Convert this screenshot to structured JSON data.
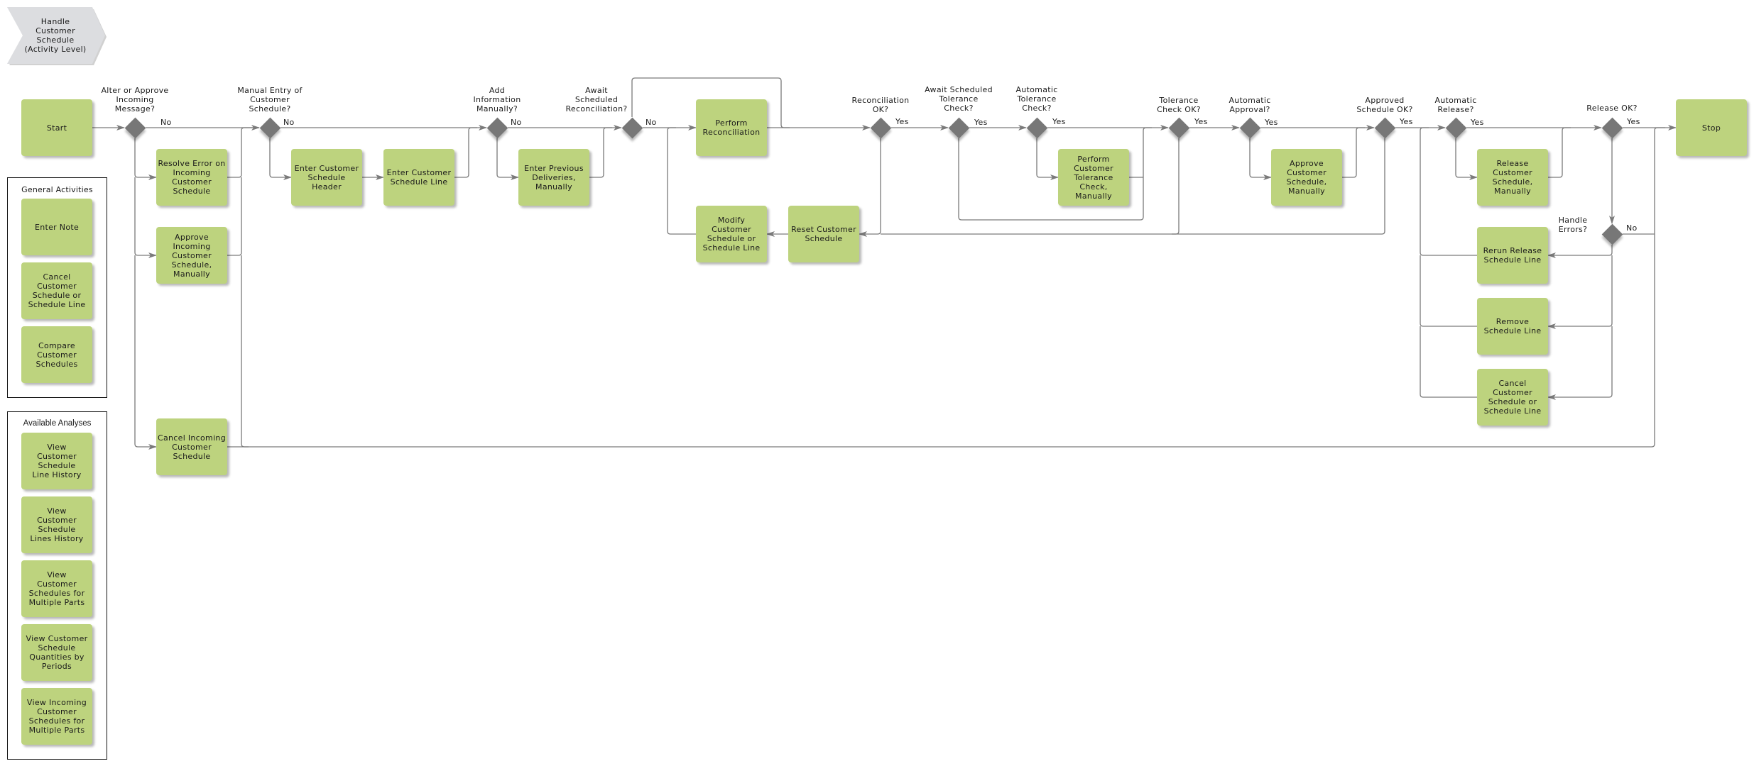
{
  "header": {
    "title": "Handle\nCustomer\nSchedule\n(Activity Level)"
  },
  "colors": {
    "activity": "#bdd37e",
    "decision": "#777777",
    "connector": "#7a7a7a",
    "header_chevron": "#dcdde0",
    "frame_border": "#111111"
  },
  "flow": {
    "start": "Start",
    "stop": "Stop",
    "activities": {
      "resolve_error": "Resolve Error on\nIncoming\nCustomer\nSchedule",
      "approve_incoming": "Approve\nIncoming\nCustomer\nSchedule,\nManually",
      "cancel_incoming": "Cancel Incoming\nCustomer\nSchedule",
      "enter_header": "Enter Customer\nSchedule\nHeader",
      "enter_line": "Enter Customer\nSchedule Line",
      "enter_previous": "Enter Previous\nDeliveries,\nManually",
      "perform_reconciliation": "Perform\nReconciliation",
      "modify_schedule": "Modify\nCustomer\nSchedule or\nSchedule Line",
      "reset_schedule": "Reset Customer\nSchedule",
      "perform_tolerance": "Perform\nCustomer\nTolerance\nCheck,\nManually",
      "approve_customer": "Approve\nCustomer\nSchedule,\nManually",
      "release_customer": "Release\nCustomer\nSchedule,\nManually",
      "rerun_release": "Rerun Release\nSchedule Line",
      "remove_line": "Remove\nSchedule Line",
      "cancel_schedule": "Cancel\nCustomer\nSchedule or\nSchedule Line"
    },
    "decisions": {
      "alter_or_approve": {
        "question": "Alter or Approve\nIncoming\nMessage?",
        "branch": "No"
      },
      "manual_entry": {
        "question": "Manual Entry of\nCustomer\nSchedule?",
        "branch": "No"
      },
      "add_information": {
        "question": "Add\nInformation\nManually?",
        "branch": "No"
      },
      "await_reconciliation": {
        "question": "Await\nScheduled\nReconciliation?",
        "branch": "No"
      },
      "reconciliation_ok": {
        "question": "Reconciliation\nOK?",
        "branch": "Yes"
      },
      "await_tolerance": {
        "question": "Await Scheduled\nTolerance\nCheck?",
        "branch": "Yes"
      },
      "automatic_tolerance": {
        "question": "Automatic\nTolerance\nCheck?",
        "branch": "Yes"
      },
      "tolerance_ok": {
        "question": "Tolerance\nCheck OK?",
        "branch": "Yes"
      },
      "automatic_approval": {
        "question": "Automatic\nApproval?",
        "branch": "Yes"
      },
      "approved_ok": {
        "question": "Approved\nSchedule OK?",
        "branch": "Yes"
      },
      "automatic_release": {
        "question": "Automatic\nRelease?",
        "branch": "Yes"
      },
      "release_ok": {
        "question": "Release OK?",
        "branch": "Yes"
      },
      "handle_errors": {
        "question": "Handle\nErrors?",
        "branch": "No"
      }
    }
  },
  "general_activities": {
    "title": "General Activities",
    "items": [
      "Enter Note",
      "Cancel\nCustomer\nSchedule or\nSchedule Line",
      "Compare\nCustomer\nSchedules"
    ]
  },
  "available_analyses": {
    "title": "Available Analyses",
    "items": [
      "View\nCustomer\nSchedule\nLine History",
      "View\nCustomer\nSchedule\nLines History",
      "View\nCustomer\nSchedules for\nMultiple Parts",
      "View Customer\nSchedule\nQuantities by\nPeriods",
      "View Incoming\nCustomer\nSchedules for\nMultiple Parts"
    ]
  }
}
